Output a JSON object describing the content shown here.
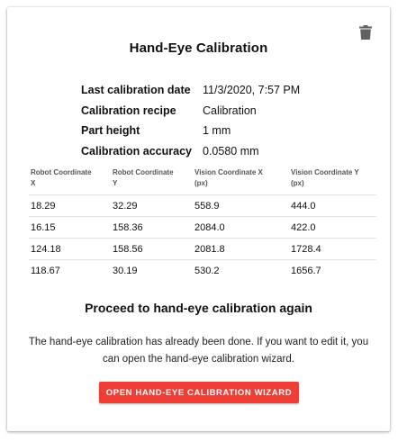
{
  "card": {
    "title": "Hand-Eye Calibration",
    "delete_icon": "trash-icon"
  },
  "info": [
    {
      "label": "Last calibration date",
      "value": "11/3/2020, 7:57 PM"
    },
    {
      "label": "Calibration recipe",
      "value": "Calibration"
    },
    {
      "label": "Part height",
      "value": "1 mm"
    },
    {
      "label": "Calibration accuracy",
      "value": "0.0580 mm"
    }
  ],
  "table": {
    "headers": [
      {
        "line1": "Robot Coordinate",
        "line2": "X"
      },
      {
        "line1": "Robot Coordinate",
        "line2": "Y"
      },
      {
        "line1": "Vision Coordinate X",
        "line2": "(px)"
      },
      {
        "line1": "Vision Coordinate Y",
        "line2": "(px)"
      }
    ],
    "rows": [
      [
        "18.29",
        "32.29",
        "558.9",
        "444.0"
      ],
      [
        "16.15",
        "158.36",
        "2084.0",
        "422.0"
      ],
      [
        "124.18",
        "158.56",
        "2081.8",
        "1728.4"
      ],
      [
        "118.67",
        "30.19",
        "530.2",
        "1656.7"
      ]
    ]
  },
  "proceed": {
    "title": "Proceed to hand-eye calibration again",
    "description": "The hand-eye calibration has already been done. If you want to edit it, you can open the hand-eye calibration wizard.",
    "button_label": "OPEN HAND-EYE CALIBRATION WIZARD"
  },
  "colors": {
    "accent": "#ef3e36",
    "icon": "#616161"
  }
}
